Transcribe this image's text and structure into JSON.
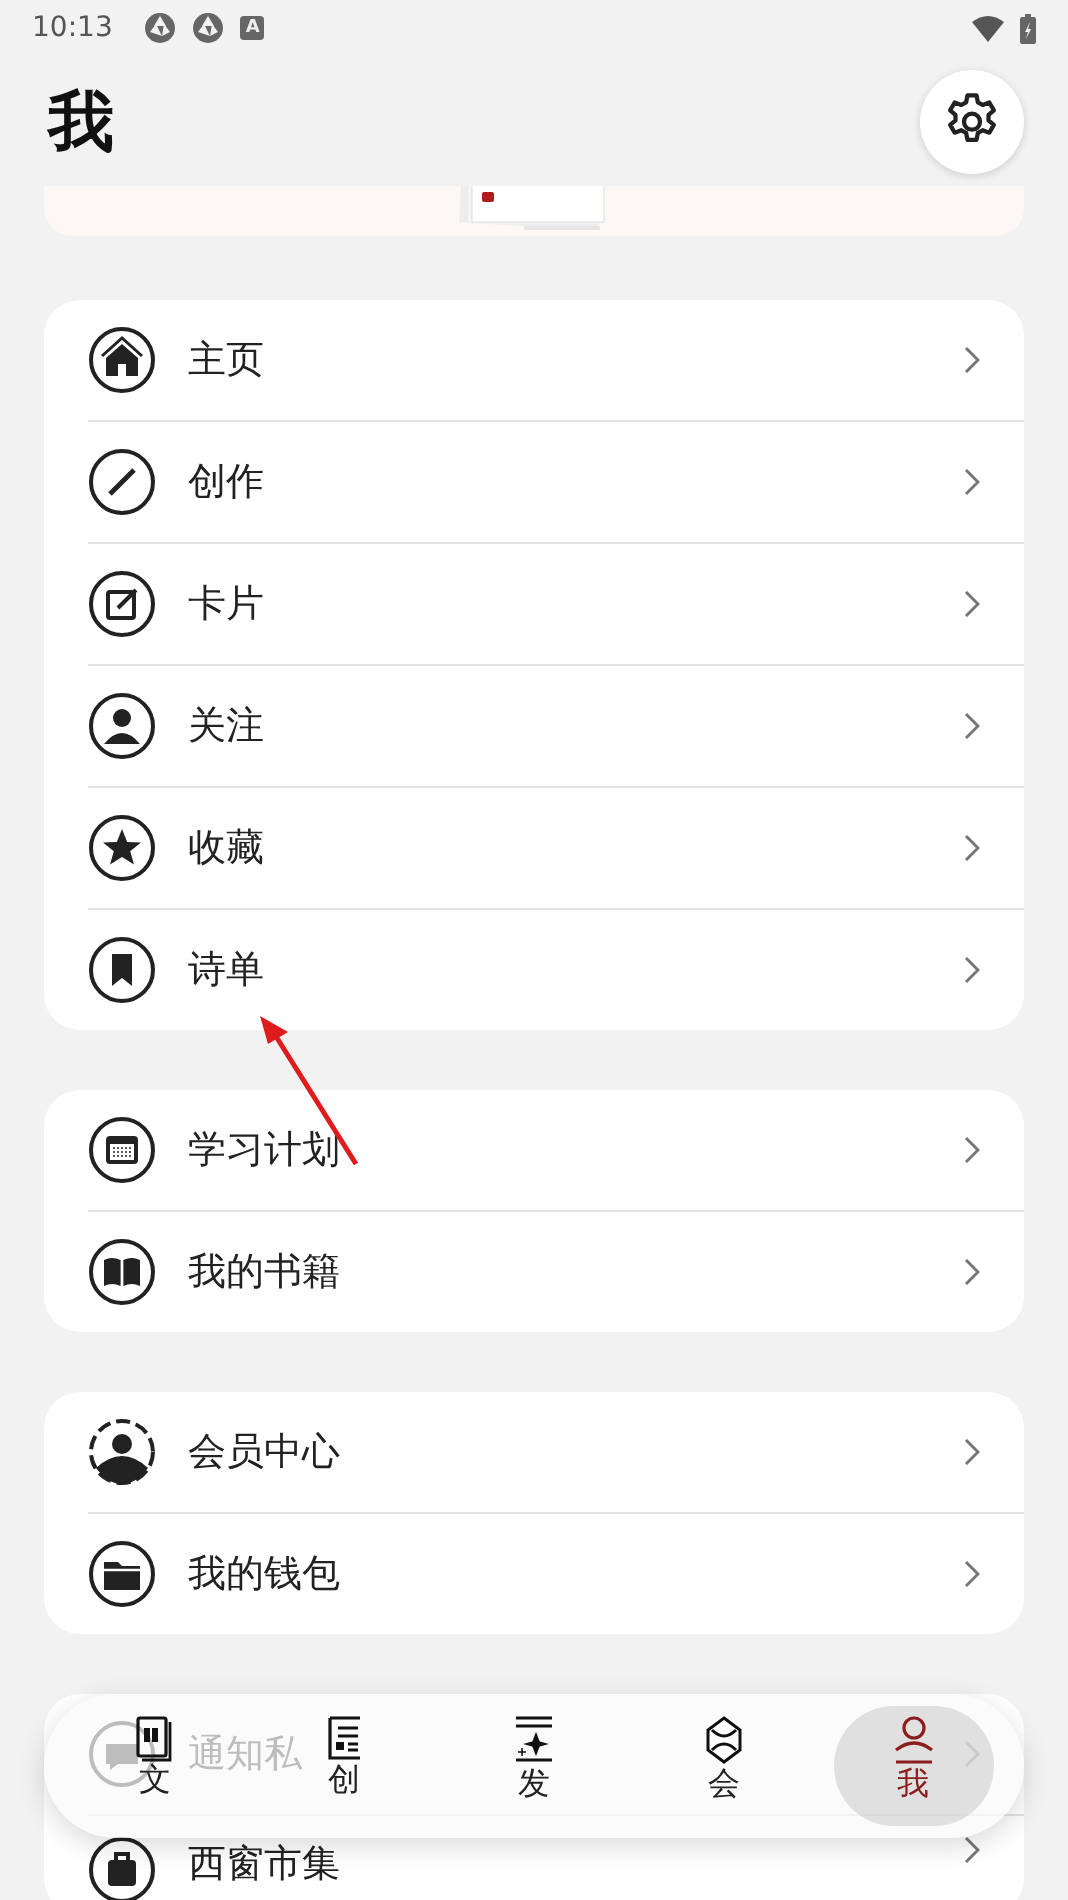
{
  "status_bar": {
    "time": "10:13",
    "notification_glyph": "A"
  },
  "header": {
    "title": "我"
  },
  "groups": [
    {
      "items": [
        {
          "label": "主页"
        },
        {
          "label": "创作"
        },
        {
          "label": "卡片"
        },
        {
          "label": "关注"
        },
        {
          "label": "收藏"
        },
        {
          "label": "诗单"
        }
      ]
    },
    {
      "items": [
        {
          "label": "学习计划"
        },
        {
          "label": "我的书籍"
        }
      ]
    },
    {
      "items": [
        {
          "label": "会员中心"
        },
        {
          "label": "我的钱包"
        }
      ]
    },
    {
      "items": [
        {
          "label": "通知私"
        },
        {
          "label": "西窗市集"
        }
      ]
    }
  ],
  "bottom_nav": [
    {
      "label": "文",
      "selected": false
    },
    {
      "label": "创",
      "selected": false
    },
    {
      "label": "发",
      "selected": false
    },
    {
      "label": "会",
      "selected": false
    },
    {
      "label": "我",
      "selected": true
    }
  ]
}
